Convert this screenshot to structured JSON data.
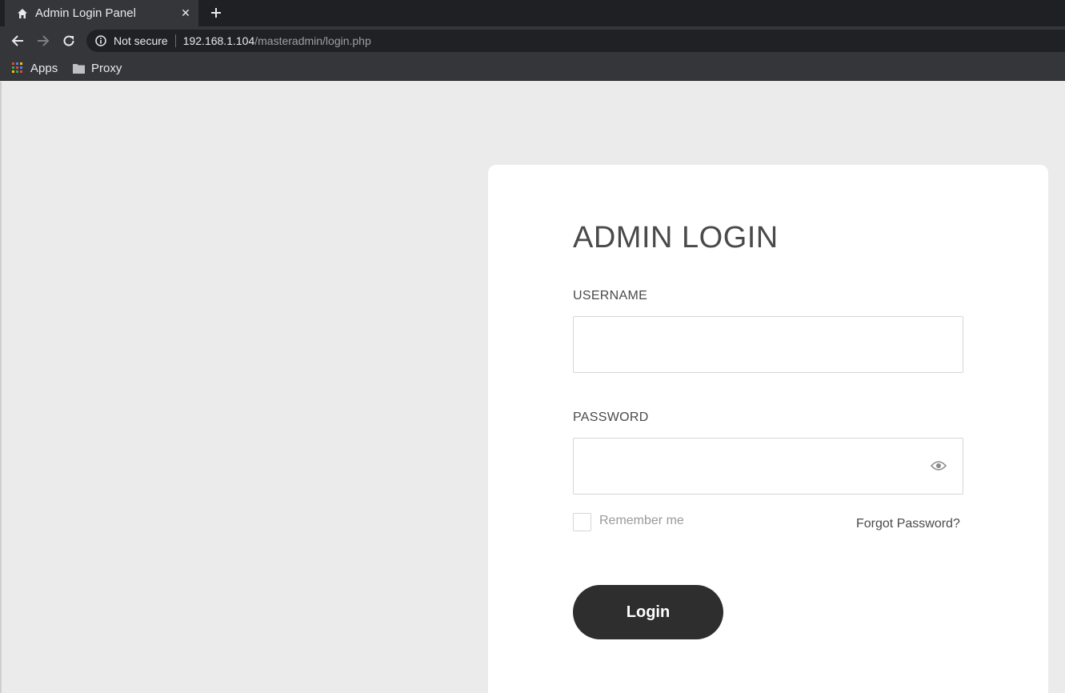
{
  "browser": {
    "tab": {
      "title": "Admin Login Panel",
      "icon": "home-icon"
    },
    "omnibox": {
      "security_text": "Not secure",
      "url_host": "192.168.1.104",
      "url_path": "/masteradmin/login.php"
    },
    "bookmarks": [
      {
        "label": "Apps",
        "icon": "apps-grid-icon"
      },
      {
        "label": "Proxy",
        "icon": "folder-icon"
      }
    ]
  },
  "login": {
    "title": "ADMIN LOGIN",
    "username_label": "USERNAME",
    "username_value": "",
    "password_label": "PASSWORD",
    "password_value": "",
    "remember_label": "Remember me",
    "forgot_label": "Forgot Password?",
    "submit_label": "Login"
  },
  "colors": {
    "page_bg": "#ebebeb",
    "card_bg": "#ffffff",
    "button_bg": "#2e2e2e",
    "text": "#4a4a4a"
  }
}
